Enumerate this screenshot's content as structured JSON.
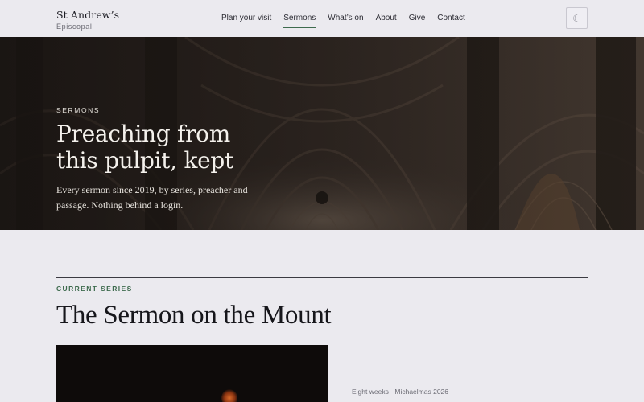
{
  "header": {
    "brand_name": "St Andrew’s",
    "brand_sub": "Episcopal",
    "nav": [
      {
        "label": "Plan your visit",
        "active": false
      },
      {
        "label": "Sermons",
        "active": true
      },
      {
        "label": "What’s on",
        "active": false
      },
      {
        "label": "About",
        "active": false
      },
      {
        "label": "Give",
        "active": false
      },
      {
        "label": "Contact",
        "active": false
      }
    ],
    "theme_toggle_icon": "moon-icon",
    "accent_color": "#3e6b4e"
  },
  "hero": {
    "eyebrow": "SERMONS",
    "title": "Preaching from this pulpit, kept",
    "description": "Every sermon since 2019, by series, preacher and passage. Nothing behind a login."
  },
  "current_series": {
    "eyebrow": "CURRENT SERIES",
    "title": "The Sermon on the Mount",
    "meta": "Eight weeks · Michaelmas 2026"
  }
}
